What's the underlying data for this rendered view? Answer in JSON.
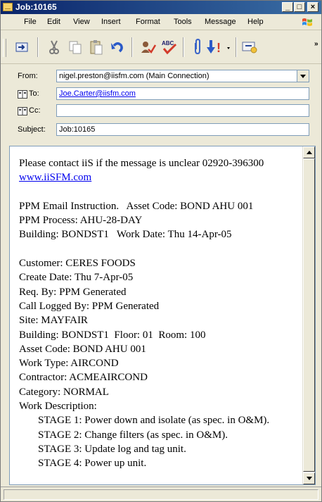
{
  "window": {
    "title": "Job:10165"
  },
  "menu": {
    "items": [
      "File",
      "Edit",
      "View",
      "Insert",
      "Format",
      "Tools",
      "Message",
      "Help"
    ]
  },
  "toolbar": {
    "icons": [
      "send-icon",
      "cut-icon",
      "copy-icon",
      "paste-icon",
      "undo-icon",
      "check-names-icon",
      "spelling-icon",
      "attach-icon",
      "priority-icon",
      "sign-icon"
    ],
    "spelling_icon_text": "ABC",
    "priority_icon_text": "!"
  },
  "header": {
    "from_label": "From:",
    "from_value": "nigel.preston@iisfm.com   (Main Connection)",
    "to_label": "To:",
    "to_value": "Joe.Carter@iisfm.com",
    "cc_label": "Cc:",
    "cc_value": "",
    "subject_label": "Subject:",
    "subject_value": "Job:10165"
  },
  "message": {
    "lines": [
      {
        "text": "Please contact iiS if the message is unclear 02920-396300"
      },
      {
        "text": "www.iiSFM.com",
        "link": true
      },
      {
        "text": ""
      },
      {
        "text": "PPM Email Instruction.   Asset Code: BOND AHU 001"
      },
      {
        "text": "PPM Process: AHU-28-DAY"
      },
      {
        "text": "Building: BONDST1   Work Date: Thu 14-Apr-05"
      },
      {
        "text": ""
      },
      {
        "text": "Customer: CERES FOODS"
      },
      {
        "text": "Create Date: Thu 7-Apr-05"
      },
      {
        "text": "Req. By: PPM Generated"
      },
      {
        "text": "Call Logged By: PPM Generated"
      },
      {
        "text": "Site: MAYFAIR"
      },
      {
        "text": "Building: BONDST1  Floor: 01  Room: 100"
      },
      {
        "text": "Asset Code: BOND AHU 001"
      },
      {
        "text": "Work Type: AIRCOND"
      },
      {
        "text": "Contractor: ACMEAIRCOND"
      },
      {
        "text": "Category: NORMAL"
      },
      {
        "text": "Work Description:"
      },
      {
        "text": "STAGE 1: Power down and isolate (as spec. in O&M).",
        "indent": true
      },
      {
        "text": "STAGE 2: Change filters (as spec. in O&M).",
        "indent": true
      },
      {
        "text": "STAGE 3: Update log and tag unit.",
        "indent": true
      },
      {
        "text": "STAGE 4: Power up unit.",
        "indent": true
      }
    ]
  },
  "status": {
    "text": ""
  },
  "colors": {
    "title_start": "#0a246a",
    "title_end": "#3a6ea5",
    "link": "#0000ee",
    "chrome": "#ece9d8"
  }
}
